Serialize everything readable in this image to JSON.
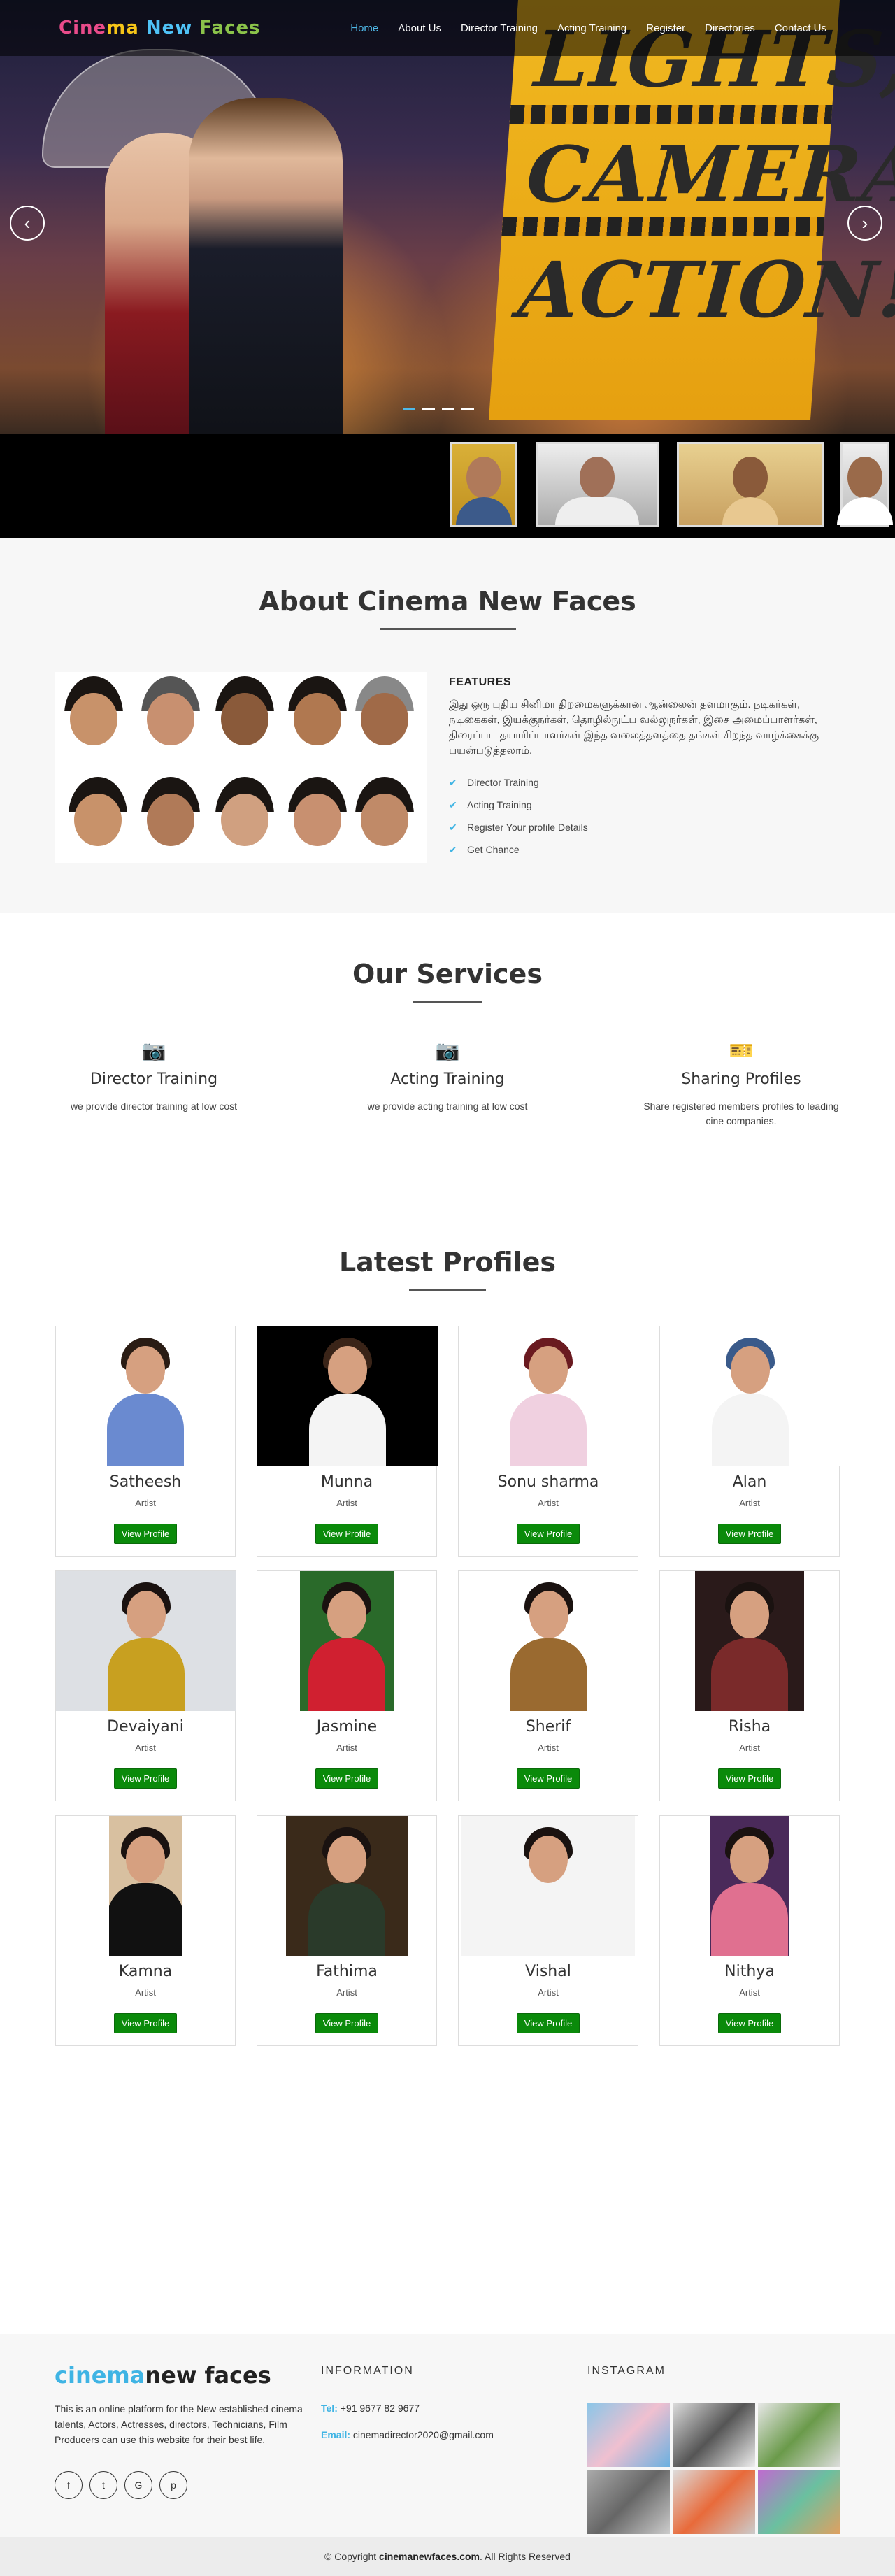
{
  "nav": {
    "logo_parts": [
      "Cine",
      "ma",
      " New",
      " Faces"
    ],
    "items": [
      "Home",
      "About Us",
      "Director Training",
      "Acting Training",
      "Register",
      "Directories",
      "Contact Us"
    ]
  },
  "hero": {
    "sign_words": [
      "LIGHTS,",
      "CAMERA,",
      "ACTION!"
    ],
    "prev": "‹",
    "next": "›",
    "slides": 4,
    "active_slide": 1
  },
  "about": {
    "title": "About Cinema New Faces",
    "features_heading": "FEATURES",
    "features_text": "இது ஒரு புதிய சினிமா திறமைகளுக்கான ஆன்லைன் தளமாகும். நடிகர்கள், நடிகைகள், இயக்குநர்கள், தொழில்நுட்ப வல்லுநர்கள், இசை அமைப்பாளர்கள், திரைப்பட தயாரிப்பாளர்கள் இந்த வலைத்தளத்தை தங்கள் சிறந்த வாழ்க்கைக்கு பயன்படுத்தலாம்.",
    "list": [
      "Director Training",
      "Acting Training",
      "Register Your profile Details",
      "Get Chance"
    ]
  },
  "services": {
    "title": "Our Services",
    "items": [
      {
        "icon": "camera-icon",
        "glyph": "📷",
        "title": "Director Training",
        "desc": "we provide director training at low cost"
      },
      {
        "icon": "camera-icon",
        "glyph": "📷",
        "title": "Acting Training",
        "desc": "we provide acting training at low cost"
      },
      {
        "icon": "ticket-icon",
        "glyph": "🎫",
        "title": "Sharing Profiles",
        "desc": "Share registered members profiles to leading cine companies."
      }
    ]
  },
  "profiles": {
    "title": "Latest Profiles",
    "button_label": "View Profile",
    "role": "Artist",
    "items": [
      {
        "name": "Satheesh"
      },
      {
        "name": "Munna"
      },
      {
        "name": "Sonu sharma"
      },
      {
        "name": "Alan"
      },
      {
        "name": "Devaiyani"
      },
      {
        "name": "Jasmine"
      },
      {
        "name": "Sherif"
      },
      {
        "name": "Risha"
      },
      {
        "name": "Kamna"
      },
      {
        "name": "Fathima"
      },
      {
        "name": "Vishal"
      },
      {
        "name": "Nithya"
      }
    ]
  },
  "footer": {
    "logo_a": "cinema",
    "logo_b": "new faces",
    "description": "This is an online platform for the New established cinema talents, Actors, Actresses, directors, Technicians, Film Producers can use this website for their best life.",
    "social": [
      "f",
      "t",
      "G",
      "p"
    ],
    "info_heading": "INFORMATION",
    "tel_label": "Tel:",
    "tel": "+91 9677 82 9677",
    "email_label": "Email:",
    "email": "cinemadirector2020@gmail.com",
    "insta_heading": "INSTAGRAM",
    "copyright_pre": "© Copyright ",
    "copyright_site": "cinemanewfaces.com",
    "copyright_post": ". All Rights Reserved"
  }
}
